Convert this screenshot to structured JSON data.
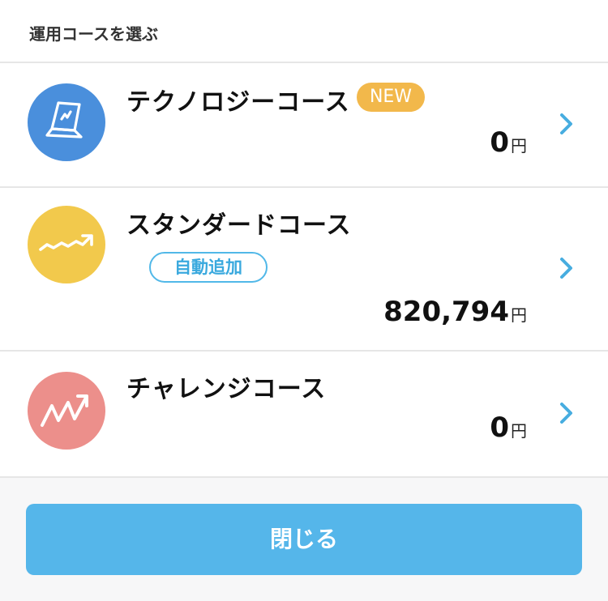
{
  "header": {
    "title": "運用コースを選ぶ"
  },
  "courses": [
    {
      "name": "テクノロジーコース",
      "badge": "NEW",
      "amount": "0",
      "unit": "円",
      "icon": "laptop-icon",
      "color": "#4a8fdc"
    },
    {
      "name": "スタンダードコース",
      "badge": "自動追加",
      "amount": "820,794",
      "unit": "円",
      "icon": "trend-line-icon",
      "color": "#f2c94c"
    },
    {
      "name": "チャレンジコース",
      "amount": "0",
      "unit": "円",
      "icon": "zigzag-growth-icon",
      "color": "#ec8f8b"
    }
  ],
  "footer": {
    "close_label": "閉じる"
  },
  "colors": {
    "accent": "#55b6ea",
    "new_badge": "#f2b84b",
    "auto_badge": "#51b8e8"
  }
}
